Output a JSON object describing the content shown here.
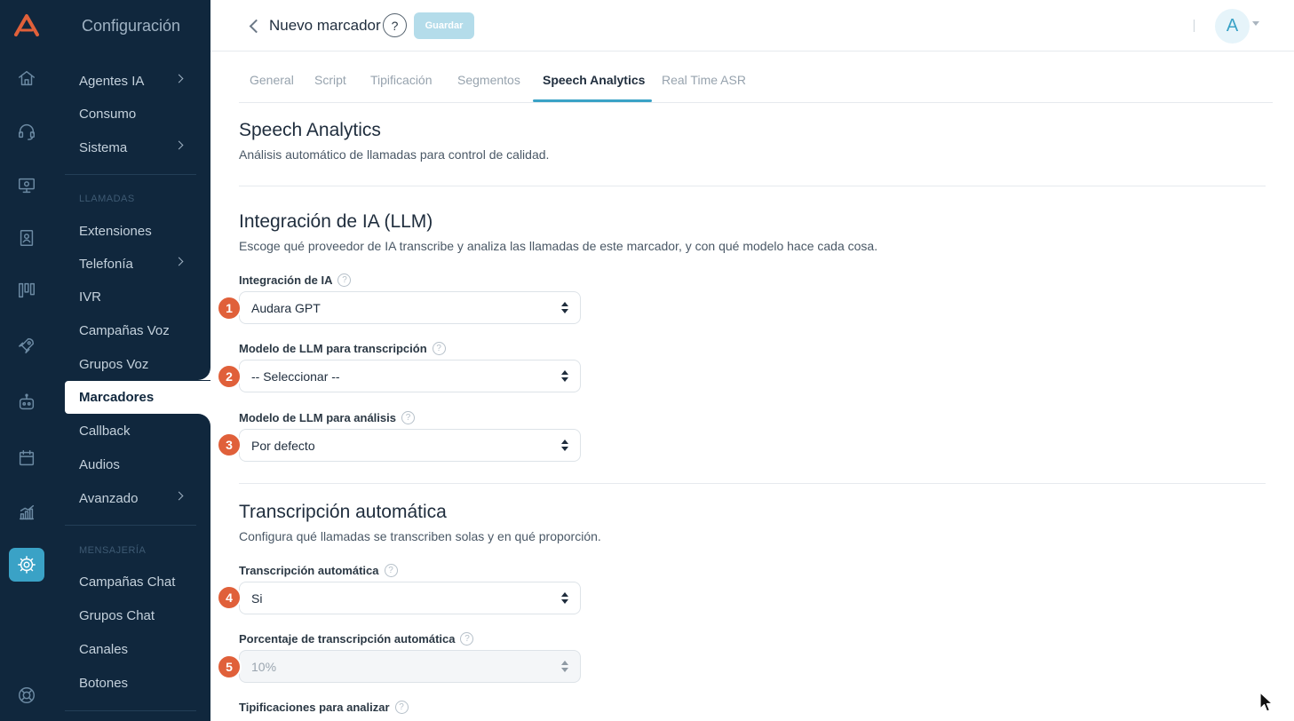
{
  "sidebar": {
    "app_title": "Configuración",
    "items": [
      {
        "label": "Agentes IA",
        "chevron": true
      },
      {
        "label": "Consumo",
        "chevron": false
      },
      {
        "label": "Sistema",
        "chevron": true
      },
      {
        "label": "Extensiones",
        "chevron": false
      },
      {
        "label": "Telefonía",
        "chevron": true
      },
      {
        "label": "IVR",
        "chevron": false
      },
      {
        "label": "Campañas Voz",
        "chevron": false
      },
      {
        "label": "Grupos Voz",
        "chevron": false
      },
      {
        "label": "Marcadores",
        "chevron": false,
        "active": true
      },
      {
        "label": "Callback",
        "chevron": false
      },
      {
        "label": "Audios",
        "chevron": false
      },
      {
        "label": "Avanzado",
        "chevron": true
      },
      {
        "label": "Campañas Chat",
        "chevron": false
      },
      {
        "label": "Grupos Chat",
        "chevron": false
      },
      {
        "label": "Canales",
        "chevron": false
      },
      {
        "label": "Botones",
        "chevron": false
      }
    ],
    "sections": {
      "llamadas": "LLAMADAS",
      "mensajeria": "MENSAJERÍA"
    }
  },
  "rail": {
    "icons": [
      "home-icon",
      "headset-icon",
      "monitor-icon",
      "contacts-icon",
      "columns-icon",
      "rocket-icon",
      "robot-icon",
      "calendar-icon",
      "analytics-icon",
      "settings-icon",
      "support-icon"
    ],
    "active": "settings-icon"
  },
  "header": {
    "title": "Nuevo marcador",
    "help": "?",
    "save_label": "Guardar",
    "avatar_initial": "A"
  },
  "tabs": [
    {
      "label": "General"
    },
    {
      "label": "Script"
    },
    {
      "label": "Tipificación"
    },
    {
      "label": "Segmentos"
    },
    {
      "label": "Speech Analytics",
      "active": true
    },
    {
      "label": "Real Time ASR"
    }
  ],
  "page": {
    "title": "Speech Analytics",
    "subtitle": "Análisis automático de llamadas para control de calidad."
  },
  "llm_section": {
    "title": "Integración de IA (LLM)",
    "subtitle": "Escoge qué proveedor de IA transcribe y analiza las llamadas de este marcador, y con qué modelo hace cada cosa.",
    "fields": [
      {
        "badge": "1",
        "label": "Integración de IA",
        "value": "Audara GPT"
      },
      {
        "badge": "2",
        "label": "Modelo de LLM para transcripción",
        "value": "-- Seleccionar --"
      },
      {
        "badge": "3",
        "label": "Modelo de LLM para análisis",
        "value": "Por defecto"
      }
    ]
  },
  "transcription_section": {
    "title": "Transcripción automática",
    "subtitle": "Configura qué llamadas se transcriben solas y en qué proporción.",
    "fields": [
      {
        "badge": "4",
        "label": "Transcripción automática",
        "value": "Si"
      },
      {
        "badge": "5",
        "label": "Porcentaje de transcripción automática",
        "value": "10%",
        "disabled": true
      },
      {
        "label": "Tipificaciones para analizar"
      }
    ]
  },
  "colors": {
    "navy": "#10273d",
    "accent": "#3aa2c6",
    "badge": "#e0603a",
    "save_disabled": "#b4dcea"
  }
}
